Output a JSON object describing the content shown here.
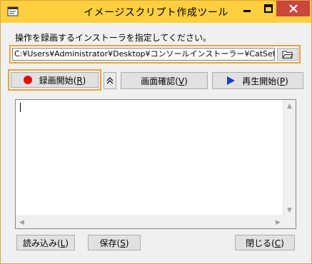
{
  "window": {
    "title": "イメージスクリプト作成ツール",
    "icon": "app-window-icon"
  },
  "caption_buttons": {
    "minimize_icon": "minimize-icon",
    "maximize_icon": "maximize-icon",
    "close_icon": "close-icon"
  },
  "form": {
    "instruction": "操作を録画するインストーラを指定してください。",
    "path_value": "C:¥Users¥Administrator¥Desktop¥コンソールインストーラー¥CatSetup.e",
    "browse_icon": "folder-open-icon"
  },
  "toolbar": {
    "record_label": "録画開始(",
    "record_key": "R",
    "record_close": ")",
    "collapse_icon": "chevron-up-icon",
    "screen_check_label": "画面確認(",
    "screen_check_key": "V",
    "screen_check_close": ")",
    "play_label": "再生開始(",
    "play_key": "P",
    "play_close": ")"
  },
  "footer": {
    "load_label": "読み込み(",
    "load_key": "L",
    "load_close": ")",
    "save_label": "保存(",
    "save_key": "S",
    "save_close": ")",
    "close_label": "閉じる(",
    "close_key": "C",
    "close_close": ")"
  },
  "colors": {
    "titlebar": "#ffcf3f",
    "close_button": "#c9473b",
    "highlight": "#e8a33a",
    "record_dot": "#e01010",
    "play_arrow": "#1a3fd1"
  }
}
